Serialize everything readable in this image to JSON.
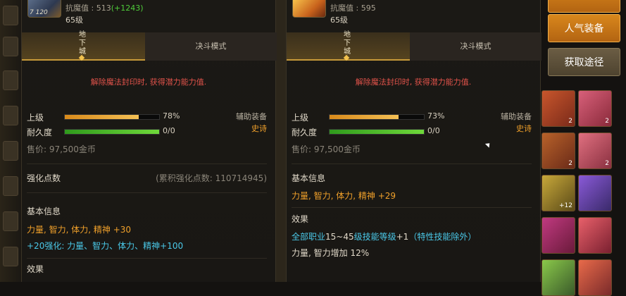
{
  "left_panel": {
    "stat_text": "抗魔值 : 513",
    "stat_bonus": "(+1243)",
    "level": "65级",
    "thumb_level": "7 120",
    "tabs": {
      "dungeon": "地\n下\n城",
      "duel": "决斗模式"
    },
    "warning": "解除魔法封印时, 获得潜力能力值.",
    "grade_label": "上级",
    "grade_pct": "78%",
    "grade_fill": 0.78,
    "durability_label": "耐久度",
    "durability_value": "0/0",
    "durability_fill": 1.0,
    "category": "辅助装备",
    "rarity": "史诗",
    "price": "售价: 97,500金币",
    "enhance_title": "强化点数",
    "enhance_total": "(累积强化点数: 110714945)",
    "basic_title": "基本信息",
    "basic_line1": "力量, 智力, 体力, 精神 +30",
    "basic_line2": "+20强化: 力量、智力、体力、精神+100",
    "effect_title": "效果"
  },
  "right_panel": {
    "stat_text": "抗魔值 : 595",
    "level": "65级",
    "tabs": {
      "dungeon": "地\n下\n城",
      "duel": "决斗模式"
    },
    "warning": "解除魔法封印时, 获得潜力能力值.",
    "grade_label": "上级",
    "grade_pct": "73%",
    "grade_fill": 0.73,
    "durability_label": "耐久度",
    "durability_value": "0/0",
    "durability_fill": 1.0,
    "category": "辅助装备",
    "rarity": "史诗",
    "price": "售价: 97,500金币",
    "basic_title": "基本信息",
    "basic_line1": "力量, 智力, 体力, 精神 +29",
    "effect_title": "效果",
    "effect_line1_prefix": "全部职业",
    "effect_line1_range": "15~45",
    "effect_line1_mid": "级技能等级",
    "effect_line1_plus": "+1",
    "effect_line1_suffix": "（特性技能除外）",
    "effect_line2": "力量, 智力增加 12%"
  },
  "sidebar": {
    "popular_gear": "人气装备",
    "get_route": "获取途径"
  },
  "inventory": [
    {
      "count": "2"
    },
    {
      "count": "2"
    },
    {
      "count": "2"
    },
    {
      "count": "2"
    },
    {
      "count": "+12"
    },
    {
      "count": ""
    },
    {
      "count": ""
    },
    {
      "count": ""
    }
  ],
  "colors": {
    "accent": "#c79a3a",
    "warning": "#e0524a",
    "stat_orange": "#f0a02a",
    "stat_cyan": "#4ac8e8",
    "bonus_green": "#4fce3a"
  }
}
